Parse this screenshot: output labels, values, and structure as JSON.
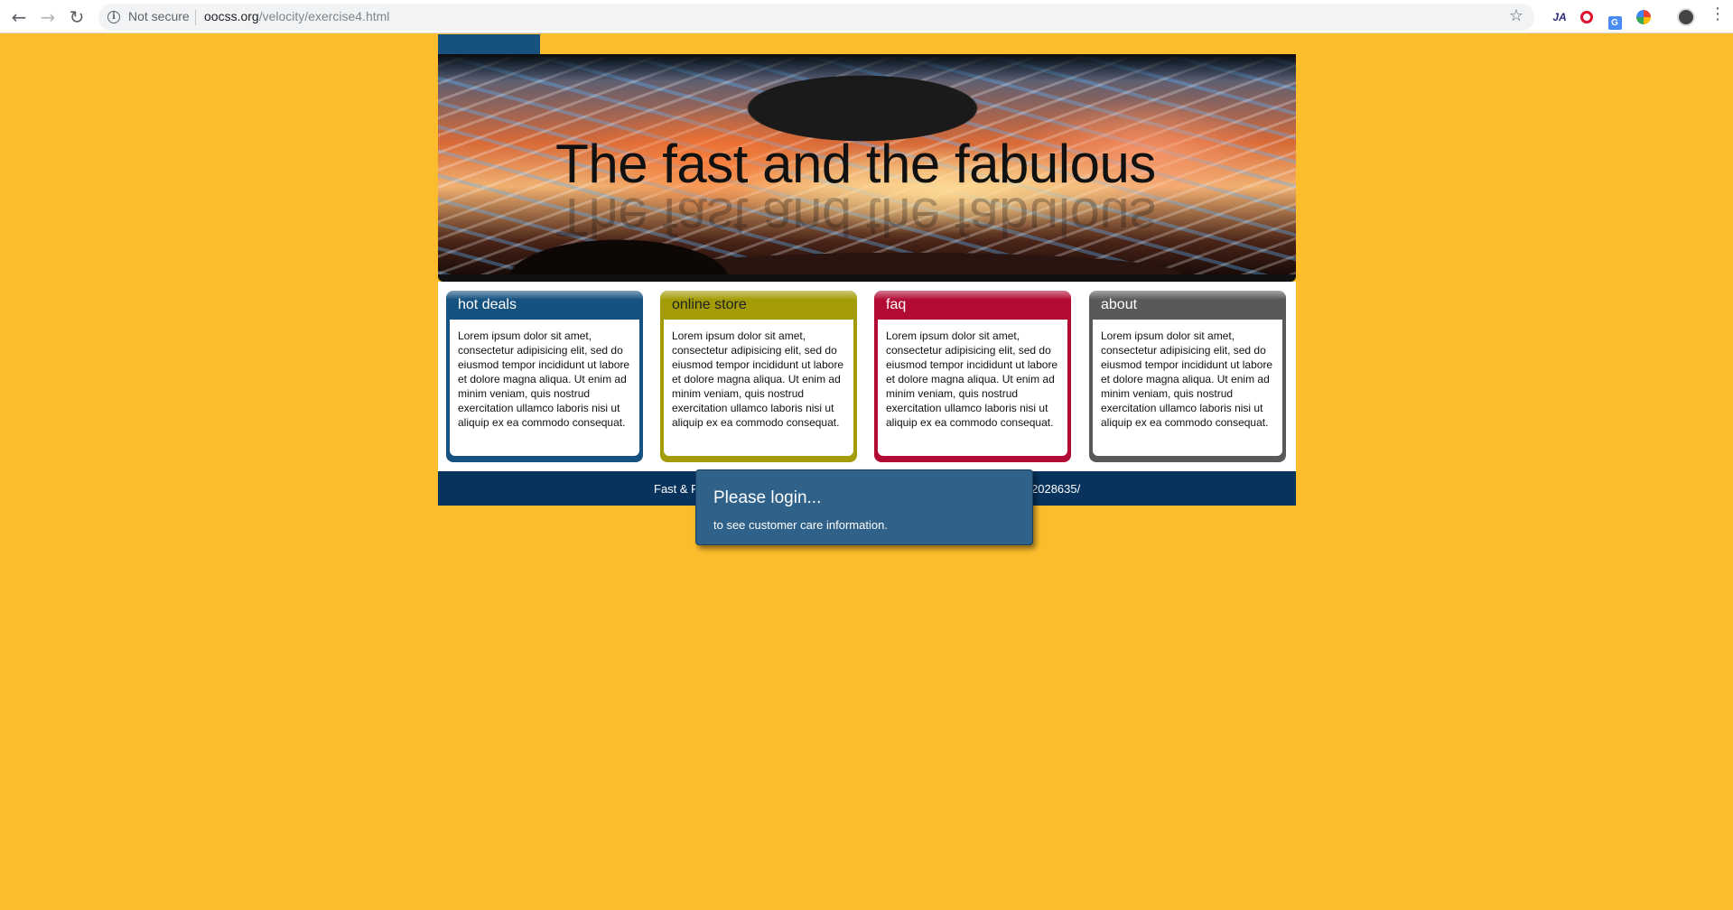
{
  "browser": {
    "back_icon": "arrow-left-icon",
    "forward_icon": "arrow-right-icon",
    "reload_icon": "reload-icon",
    "security_label": "Not secure",
    "url_host": "oocss.org",
    "url_path": "/velocity/exercise4.html",
    "extensions": [
      "JA",
      "opera-icon",
      "translate-icon",
      "color-picker-icon"
    ]
  },
  "hero": {
    "title": "The fast and the fabulous"
  },
  "boxes": [
    {
      "title": "hot deals",
      "color": "#15527f",
      "body": "Lorem ipsum dolor sit amet, consectetur adipisicing elit, sed do eiusmod tempor incididunt ut labore et dolore magna aliqua. Ut enim ad minim veniam, quis nostrud exercitation ullamco laboris nisi ut aliquip ex ea commodo consequat."
    },
    {
      "title": "online store",
      "color": "#a39c06",
      "body": "Lorem ipsum dolor sit amet, consectetur adipisicing elit, sed do eiusmod tempor incididunt ut labore et dolore magna aliqua. Ut enim ad minim veniam, quis nostrud exercitation ullamco laboris nisi ut aliquip ex ea commodo consequat."
    },
    {
      "title": "faq",
      "color": "#b20c35",
      "body": "Lorem ipsum dolor sit amet, consectetur adipisicing elit, sed do eiusmod tempor incididunt ut labore et dolore magna aliqua. Ut enim ad minim veniam, quis nostrud exercitation ullamco laboris nisi ut aliquip ex ea commodo consequat."
    },
    {
      "title": "about",
      "color": "#595959",
      "body": "Lorem ipsum dolor sit amet, consectetur adipisicing elit, sed do eiusmod tempor incididunt ut labore et dolore magna aliqua. Ut enim ad minim veniam, quis nostrud exercitation ullamco laboris nisi ut aliquip ex ea commodo consequat."
    }
  ],
  "footer": {
    "left_text": "Fast & F",
    "right_text": "2028635/"
  },
  "popup": {
    "title": "Please login...",
    "text": "to see customer care information."
  },
  "colors": {
    "page_background": "#fbbd2c",
    "footer": "#07335d",
    "popup": "#2f6189"
  }
}
